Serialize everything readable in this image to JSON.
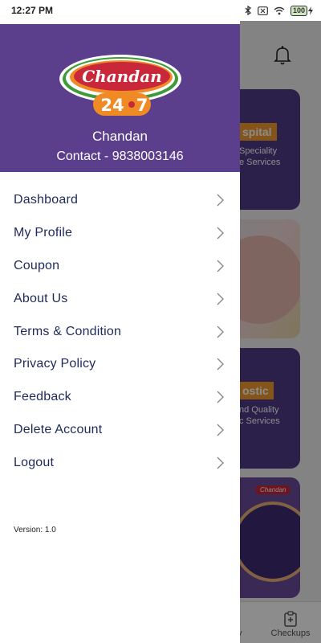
{
  "status_bar": {
    "time": "12:27 PM",
    "battery": "100"
  },
  "drawer": {
    "logo_text": "Chandan",
    "logo_number_left": "24",
    "logo_number_right": "7",
    "user_name": "Chandan",
    "contact": "Contact - 9838003146",
    "menu": [
      {
        "label": "Dashboard"
      },
      {
        "label": "My Profile"
      },
      {
        "label": "Coupon"
      },
      {
        "label": "About Us"
      },
      {
        "label": "Terms & Condition"
      },
      {
        "label": "Privacy Policy"
      },
      {
        "label": "Feedback"
      },
      {
        "label": "Delete Account"
      },
      {
        "label": "Logout"
      }
    ],
    "version": "Version: 1.0"
  },
  "background": {
    "card1_tag": "spital",
    "card1_sub_line1": "Speciality",
    "card1_sub_line2": "e Services",
    "card3_tag": "ostic",
    "card3_sub_line1": "nd Quality",
    "card3_sub_line2": "c Services",
    "card4_logo": "Chandan",
    "nav_partial": "y",
    "nav_checkups": "Checkups"
  },
  "colors": {
    "header_purple": "#5b3f8c",
    "menu_text": "#1e2a5a",
    "accent_orange": "#f29a2e",
    "logo_red": "#c8283a"
  }
}
